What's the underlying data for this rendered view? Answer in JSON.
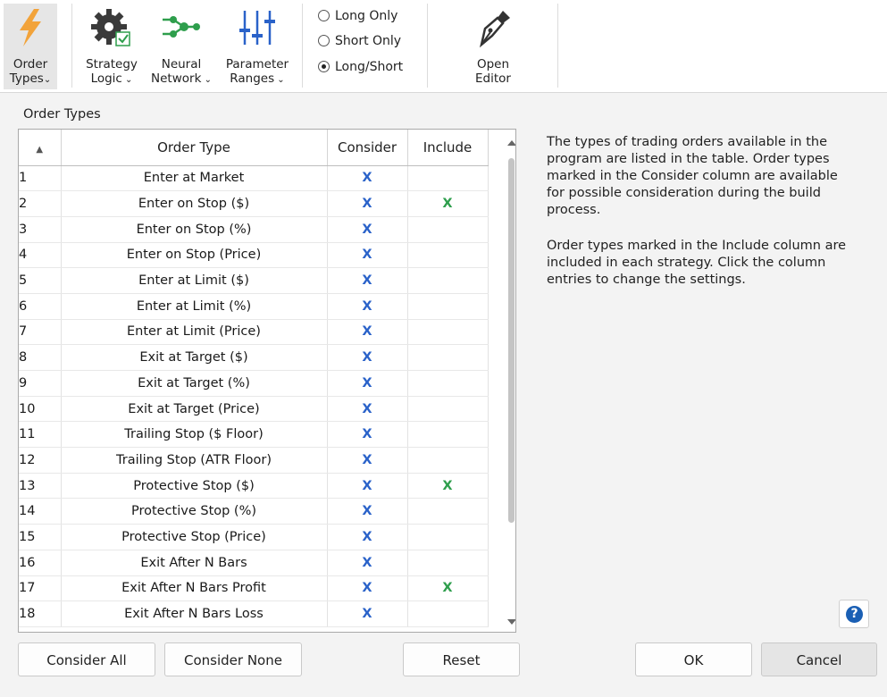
{
  "ribbon": {
    "order_types": {
      "line1": "Order",
      "line2": "Types"
    },
    "strategy_logic": {
      "line1": "Strategy",
      "line2": "Logic"
    },
    "neural_network": {
      "line1": "Neural",
      "line2": "Network"
    },
    "parameter_ranges": {
      "line1": "Parameter",
      "line2": "Ranges"
    },
    "position_options": [
      "Long Only",
      "Short Only",
      "Long/Short"
    ],
    "position_selected": "Long/Short",
    "open_editor": {
      "line1": "Open",
      "line2": "Editor"
    }
  },
  "section_title": "Order Types",
  "table": {
    "sort_indicator": "▲",
    "headers": [
      "Order Type",
      "Consider",
      "Include"
    ],
    "rows": [
      {
        "num": "1",
        "name": "Enter at Market",
        "consider": "X",
        "include": ""
      },
      {
        "num": "2",
        "name": "Enter on Stop ($)",
        "consider": "X",
        "include": "X"
      },
      {
        "num": "3",
        "name": "Enter on Stop (%)",
        "consider": "X",
        "include": ""
      },
      {
        "num": "4",
        "name": "Enter on Stop (Price)",
        "consider": "X",
        "include": ""
      },
      {
        "num": "5",
        "name": "Enter at Limit ($)",
        "consider": "X",
        "include": ""
      },
      {
        "num": "6",
        "name": "Enter at Limit (%)",
        "consider": "X",
        "include": ""
      },
      {
        "num": "7",
        "name": "Enter at Limit (Price)",
        "consider": "X",
        "include": ""
      },
      {
        "num": "8",
        "name": "Exit at Target ($)",
        "consider": "X",
        "include": ""
      },
      {
        "num": "9",
        "name": "Exit at Target (%)",
        "consider": "X",
        "include": ""
      },
      {
        "num": "10",
        "name": "Exit at Target (Price)",
        "consider": "X",
        "include": ""
      },
      {
        "num": "11",
        "name": "Trailing Stop ($ Floor)",
        "consider": "X",
        "include": ""
      },
      {
        "num": "12",
        "name": "Trailing Stop (ATR Floor)",
        "consider": "X",
        "include": ""
      },
      {
        "num": "13",
        "name": "Protective Stop ($)",
        "consider": "X",
        "include": "X"
      },
      {
        "num": "14",
        "name": "Protective Stop (%)",
        "consider": "X",
        "include": ""
      },
      {
        "num": "15",
        "name": "Protective Stop (Price)",
        "consider": "X",
        "include": ""
      },
      {
        "num": "16",
        "name": "Exit After N Bars",
        "consider": "X",
        "include": ""
      },
      {
        "num": "17",
        "name": "Exit After N Bars Profit",
        "consider": "X",
        "include": "X"
      },
      {
        "num": "18",
        "name": "Exit After N Bars Loss",
        "consider": "X",
        "include": ""
      }
    ]
  },
  "help": {
    "paragraph1": "The types of trading orders available in the program are listed in the table. Order types marked in the Consider column are available for possible consideration during the build process.",
    "paragraph2": "Order types marked in the Include column are included in each strategy. Click the column entries to change the settings.",
    "help_icon": "?"
  },
  "buttons": {
    "consider_all": "Consider All",
    "consider_none": "Consider None",
    "reset": "Reset",
    "ok": "OK",
    "cancel": "Cancel"
  },
  "colors": {
    "consider_x": "#2a62c9",
    "include_x": "#2e9e4c",
    "accent": "#1a5fb4",
    "lightning": "#f2a33a"
  },
  "icons": {
    "order_types": "lightning-icon",
    "strategy_logic": "gear-check-icon",
    "neural_network": "neural-network-icon",
    "parameter_ranges": "sliders-icon",
    "open_editor": "pen-nib-icon",
    "help": "question-icon"
  }
}
